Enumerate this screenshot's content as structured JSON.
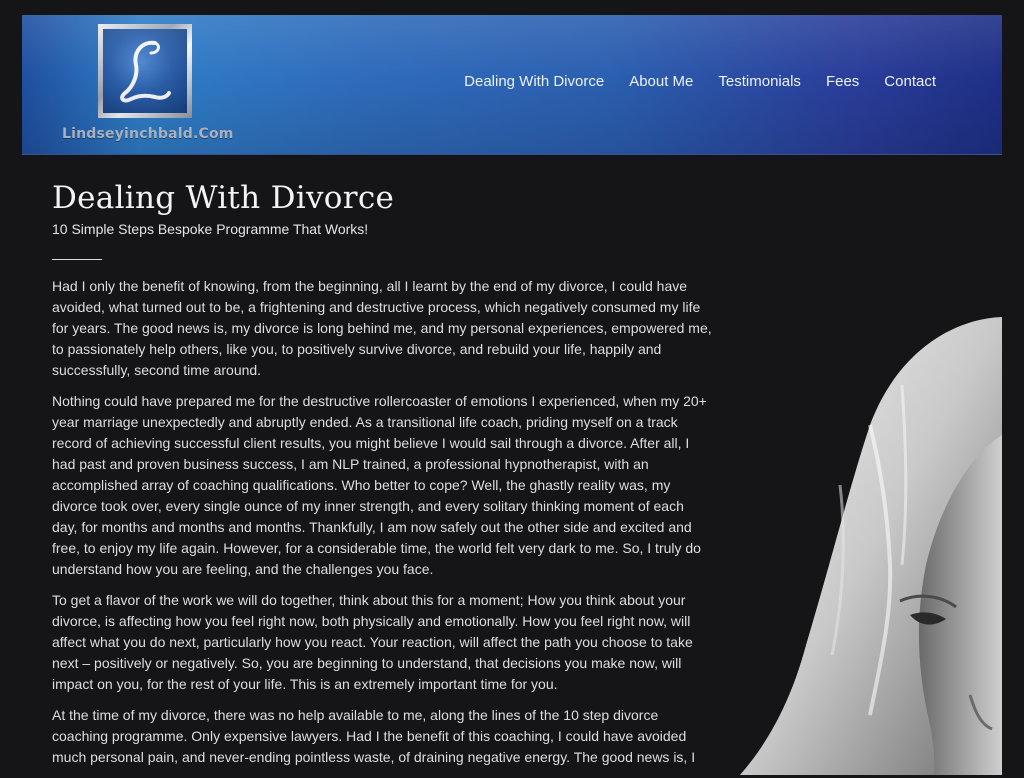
{
  "header": {
    "logo_text": "Lindseyinchbald.Com",
    "logo_letter": "L",
    "nav": [
      {
        "label": "Dealing With Divorce"
      },
      {
        "label": "About Me"
      },
      {
        "label": "Testimonials"
      },
      {
        "label": "Fees"
      },
      {
        "label": "Contact"
      }
    ]
  },
  "main": {
    "title": "Dealing With Divorce",
    "subtitle": "10 Simple Steps Bespoke Programme That Works!",
    "paragraphs": [
      "Had I only the benefit of knowing, from the beginning, all I learnt by the end of my divorce, I could have avoided, what turned out to be, a frightening and destructive process, which negatively consumed my life for years. The good news is, my divorce is long behind me, and my personal experiences, empowered me, to passionately help others, like you, to positively survive divorce, and rebuild your life, happily and successfully, second time around.",
      "Nothing could have prepared me for the destructive rollercoaster of emotions I experienced, when my 20+ year marriage unexpectedly and abruptly ended. As a transitional life coach, priding myself on a track record of achieving successful client results, you might believe I would sail through a divorce. After all, I had past and proven business success, I am NLP trained, a professional hypnotherapist, with an accomplished array of coaching qualifications. Who better to cope? Well, the ghastly reality was, my divorce took over, every single ounce of my inner strength, and every solitary thinking moment of each day, for months and months and months. Thankfully, I am now safely out the other side and excited and free, to enjoy my life again. However, for a considerable time, the world felt very dark to me. So, I truly do understand how you are feeling, and the challenges you face.",
      "To get a flavor of the work we will do together, think about this for a moment; How you think about your divorce, is affecting how you feel right now, both physically and emotionally. How you feel right now, will affect what you do next, particularly how you react. Your reaction, will affect the path you choose to take next – positively or negatively. So, you are beginning to understand, that decisions you make now, will impact on you, for the rest of your life. This is an extremely important time for you.",
      "At the time of my divorce, there was no help available to me, along the lines of the 10 step divorce coaching programme. Only expensive lawyers. Had I the benefit of this coaching, I could have avoided much personal pain, and never-ending pointless waste, of draining negative energy. The good news is, I"
    ]
  }
}
